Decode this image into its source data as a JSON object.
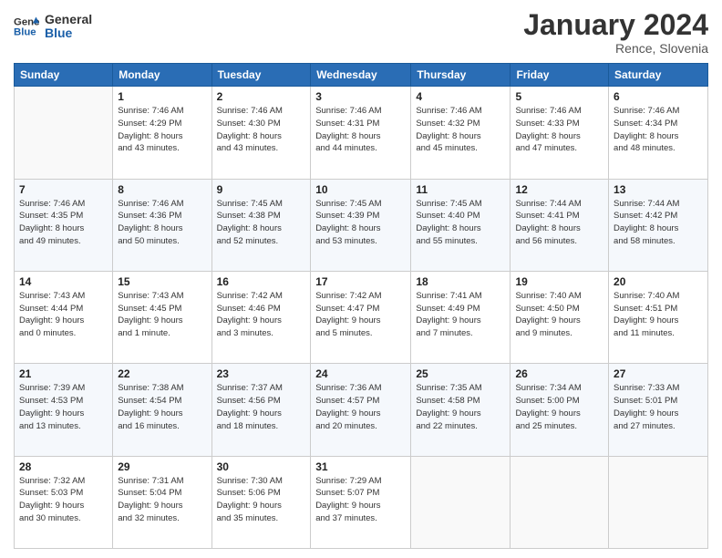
{
  "header": {
    "logo_general": "General",
    "logo_blue": "Blue",
    "title": "January 2024",
    "location": "Rence, Slovenia"
  },
  "columns": [
    "Sunday",
    "Monday",
    "Tuesday",
    "Wednesday",
    "Thursday",
    "Friday",
    "Saturday"
  ],
  "weeks": [
    [
      {
        "day": "",
        "info": ""
      },
      {
        "day": "1",
        "info": "Sunrise: 7:46 AM\nSunset: 4:29 PM\nDaylight: 8 hours\nand 43 minutes."
      },
      {
        "day": "2",
        "info": "Sunrise: 7:46 AM\nSunset: 4:30 PM\nDaylight: 8 hours\nand 43 minutes."
      },
      {
        "day": "3",
        "info": "Sunrise: 7:46 AM\nSunset: 4:31 PM\nDaylight: 8 hours\nand 44 minutes."
      },
      {
        "day": "4",
        "info": "Sunrise: 7:46 AM\nSunset: 4:32 PM\nDaylight: 8 hours\nand 45 minutes."
      },
      {
        "day": "5",
        "info": "Sunrise: 7:46 AM\nSunset: 4:33 PM\nDaylight: 8 hours\nand 47 minutes."
      },
      {
        "day": "6",
        "info": "Sunrise: 7:46 AM\nSunset: 4:34 PM\nDaylight: 8 hours\nand 48 minutes."
      }
    ],
    [
      {
        "day": "7",
        "info": "Sunrise: 7:46 AM\nSunset: 4:35 PM\nDaylight: 8 hours\nand 49 minutes."
      },
      {
        "day": "8",
        "info": "Sunrise: 7:46 AM\nSunset: 4:36 PM\nDaylight: 8 hours\nand 50 minutes."
      },
      {
        "day": "9",
        "info": "Sunrise: 7:45 AM\nSunset: 4:38 PM\nDaylight: 8 hours\nand 52 minutes."
      },
      {
        "day": "10",
        "info": "Sunrise: 7:45 AM\nSunset: 4:39 PM\nDaylight: 8 hours\nand 53 minutes."
      },
      {
        "day": "11",
        "info": "Sunrise: 7:45 AM\nSunset: 4:40 PM\nDaylight: 8 hours\nand 55 minutes."
      },
      {
        "day": "12",
        "info": "Sunrise: 7:44 AM\nSunset: 4:41 PM\nDaylight: 8 hours\nand 56 minutes."
      },
      {
        "day": "13",
        "info": "Sunrise: 7:44 AM\nSunset: 4:42 PM\nDaylight: 8 hours\nand 58 minutes."
      }
    ],
    [
      {
        "day": "14",
        "info": "Sunrise: 7:43 AM\nSunset: 4:44 PM\nDaylight: 9 hours\nand 0 minutes."
      },
      {
        "day": "15",
        "info": "Sunrise: 7:43 AM\nSunset: 4:45 PM\nDaylight: 9 hours\nand 1 minute."
      },
      {
        "day": "16",
        "info": "Sunrise: 7:42 AM\nSunset: 4:46 PM\nDaylight: 9 hours\nand 3 minutes."
      },
      {
        "day": "17",
        "info": "Sunrise: 7:42 AM\nSunset: 4:47 PM\nDaylight: 9 hours\nand 5 minutes."
      },
      {
        "day": "18",
        "info": "Sunrise: 7:41 AM\nSunset: 4:49 PM\nDaylight: 9 hours\nand 7 minutes."
      },
      {
        "day": "19",
        "info": "Sunrise: 7:40 AM\nSunset: 4:50 PM\nDaylight: 9 hours\nand 9 minutes."
      },
      {
        "day": "20",
        "info": "Sunrise: 7:40 AM\nSunset: 4:51 PM\nDaylight: 9 hours\nand 11 minutes."
      }
    ],
    [
      {
        "day": "21",
        "info": "Sunrise: 7:39 AM\nSunset: 4:53 PM\nDaylight: 9 hours\nand 13 minutes."
      },
      {
        "day": "22",
        "info": "Sunrise: 7:38 AM\nSunset: 4:54 PM\nDaylight: 9 hours\nand 16 minutes."
      },
      {
        "day": "23",
        "info": "Sunrise: 7:37 AM\nSunset: 4:56 PM\nDaylight: 9 hours\nand 18 minutes."
      },
      {
        "day": "24",
        "info": "Sunrise: 7:36 AM\nSunset: 4:57 PM\nDaylight: 9 hours\nand 20 minutes."
      },
      {
        "day": "25",
        "info": "Sunrise: 7:35 AM\nSunset: 4:58 PM\nDaylight: 9 hours\nand 22 minutes."
      },
      {
        "day": "26",
        "info": "Sunrise: 7:34 AM\nSunset: 5:00 PM\nDaylight: 9 hours\nand 25 minutes."
      },
      {
        "day": "27",
        "info": "Sunrise: 7:33 AM\nSunset: 5:01 PM\nDaylight: 9 hours\nand 27 minutes."
      }
    ],
    [
      {
        "day": "28",
        "info": "Sunrise: 7:32 AM\nSunset: 5:03 PM\nDaylight: 9 hours\nand 30 minutes."
      },
      {
        "day": "29",
        "info": "Sunrise: 7:31 AM\nSunset: 5:04 PM\nDaylight: 9 hours\nand 32 minutes."
      },
      {
        "day": "30",
        "info": "Sunrise: 7:30 AM\nSunset: 5:06 PM\nDaylight: 9 hours\nand 35 minutes."
      },
      {
        "day": "31",
        "info": "Sunrise: 7:29 AM\nSunset: 5:07 PM\nDaylight: 9 hours\nand 37 minutes."
      },
      {
        "day": "",
        "info": ""
      },
      {
        "day": "",
        "info": ""
      },
      {
        "day": "",
        "info": ""
      }
    ]
  ]
}
